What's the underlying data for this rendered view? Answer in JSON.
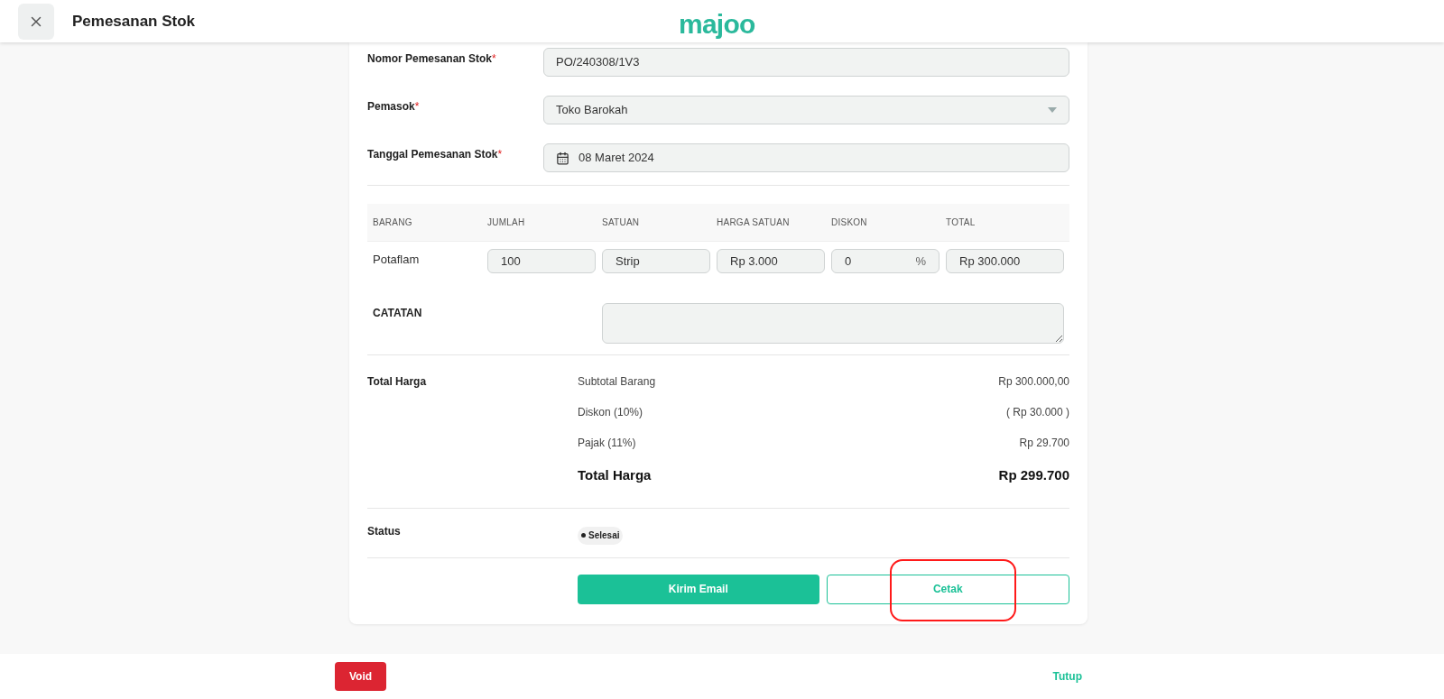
{
  "header": {
    "title": "Pemesanan Stok",
    "logo": "majoo"
  },
  "form": [
    {
      "label": "Nomor Pemesanan Stok",
      "required_mark": "*",
      "kind": "text",
      "value": "PO/240308/1V3"
    },
    {
      "label": "Pemasok",
      "required_mark": "*",
      "kind": "select",
      "value": "Toko Barokah"
    },
    {
      "label": "Tanggal Pemesanan Stok",
      "required_mark": "*",
      "kind": "date",
      "value": "08 Maret 2024"
    }
  ],
  "table": {
    "columns": [
      "BARANG",
      "JUMLAH",
      "SATUAN",
      "HARGA SATUAN",
      "DISKON",
      "TOTAL"
    ],
    "rows": [
      {
        "item": "Potaflam",
        "qty": "100",
        "unit": "Strip",
        "price": "Rp 3.000",
        "discount": "0",
        "discount_suffix": "%",
        "total": "Rp 300.000"
      }
    ]
  },
  "notes": {
    "label": "CATATAN"
  },
  "summary": {
    "label": "Total Harga",
    "lines": [
      {
        "label": "Subtotal Barang",
        "value": "Rp 300.000,00"
      },
      {
        "label": "Diskon (10%)",
        "value": "( Rp 30.000 )"
      },
      {
        "label": "Pajak (11%)",
        "value": "Rp 29.700"
      }
    ],
    "total": {
      "label": "Total Harga",
      "value": "Rp 299.700"
    }
  },
  "status": {
    "label": "Status",
    "value": "Selesai"
  },
  "actions": [
    "Kirim Email",
    "Cetak"
  ],
  "footer": {
    "void": "Void",
    "close": "Tutup"
  }
}
